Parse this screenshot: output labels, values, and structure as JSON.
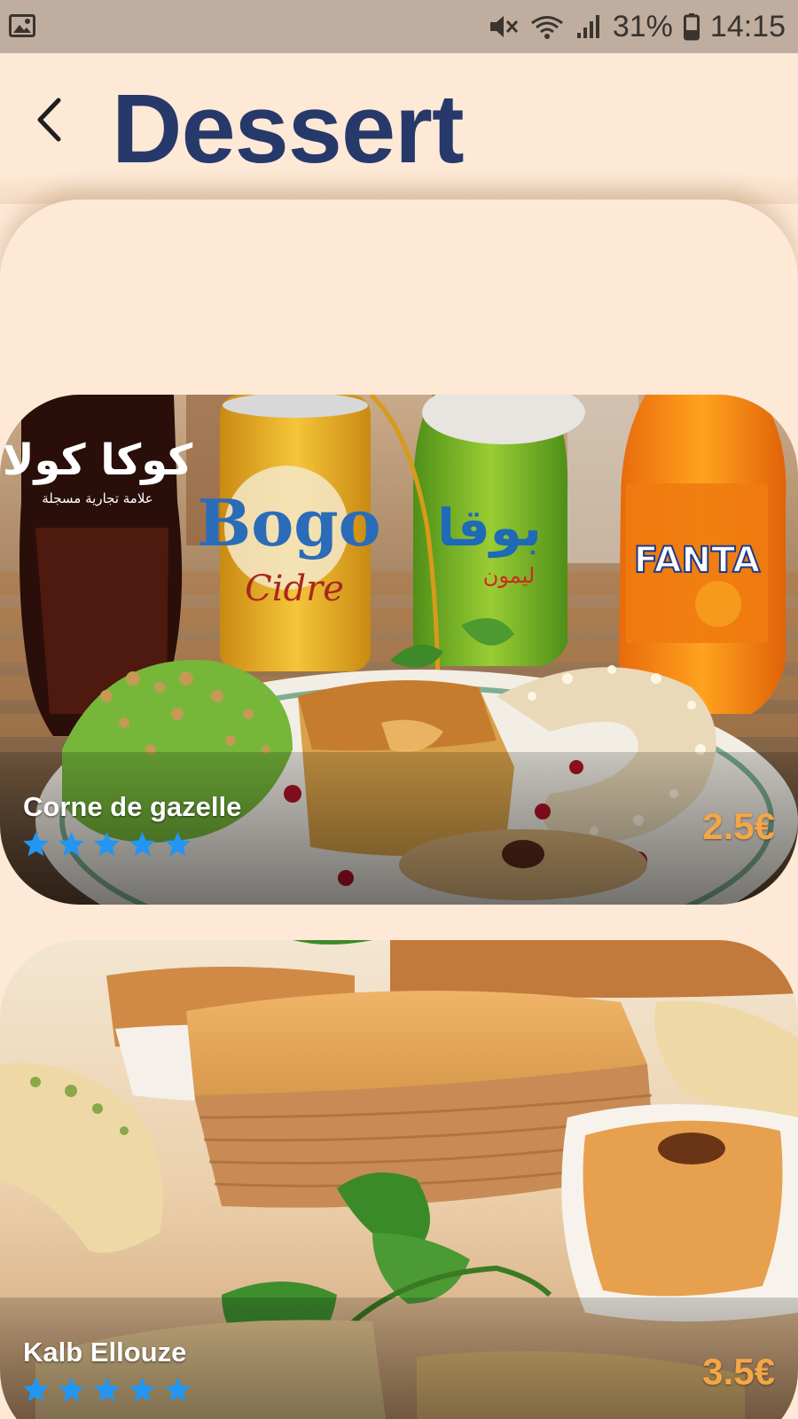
{
  "status_bar": {
    "battery": "31%",
    "time": "14:15",
    "icons": [
      "gallery-icon",
      "mute-icon",
      "wifi-icon",
      "signal-icon",
      "battery-icon"
    ]
  },
  "header": {
    "back_icon": "chevron-left-icon",
    "title": "Dessert"
  },
  "dishes": [
    {
      "name": "Corne de gazelle",
      "rating": 5,
      "price": "2.5€",
      "image": "soft drinks (Coca-Cola, Boga Cidre, Boga, Fanta) with pastries"
    },
    {
      "name": "Kalb Ellouze",
      "rating": 5,
      "price": "3.5€",
      "image": "tray of layered almond pastries and mint"
    }
  ],
  "colors": {
    "background": "#FDE9D6",
    "status_bar": "#BFAE9F",
    "title": "#27396A",
    "price": "#F4A646",
    "star": "#2196F3"
  }
}
